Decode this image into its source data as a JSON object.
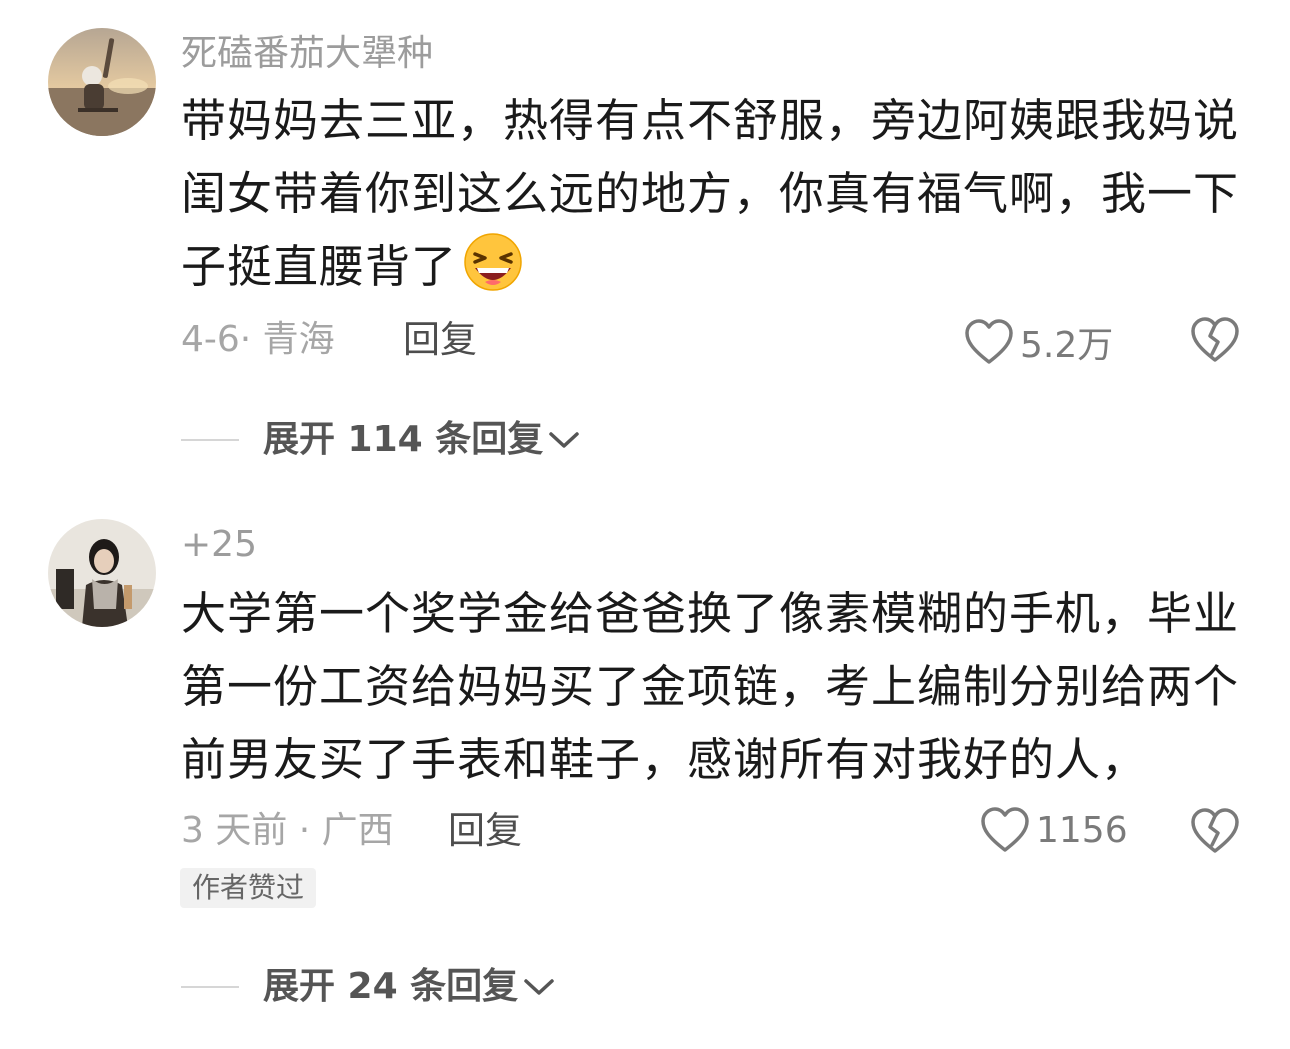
{
  "comments": [
    {
      "username": "死磕番茄大犟种",
      "avatar": "sunset-beach-avatar",
      "lines": [
        "带妈妈去三亚，热得有点不舒服，旁边阿姨跟我妈说",
        "闺女带着你到这么远的地方，你真有福气啊，我一下",
        "子挺直腰背了"
      ],
      "emoji": "laughing-face-emoji",
      "meta": "4-6· 青海",
      "reply_label": "回复",
      "like_count": "5.2万",
      "expand_label": "展开 114 条回复"
    },
    {
      "username": "+25",
      "avatar": "person-scarf-avatar",
      "lines": [
        "大学第一个奖学金给爸爸换了像素模糊的手机，毕业",
        "第一份工资给妈妈买了金项链，考上编制分别给两个",
        "前男友买了手表和鞋子，感谢所有对我好的人，"
      ],
      "meta": "3 天前 · 广西",
      "reply_label": "回复",
      "like_count": "1156",
      "badge": "作者赞过",
      "expand_label": "展开 24 条回复"
    }
  ],
  "icons": {
    "like": "heart-outline-icon",
    "dislike": "broken-heart-icon",
    "expand": "chevron-down-icon"
  },
  "colors": {
    "text_primary": "#1a1a1a",
    "text_secondary": "#9c9c9c",
    "badge_bg": "#f1f1f1"
  }
}
